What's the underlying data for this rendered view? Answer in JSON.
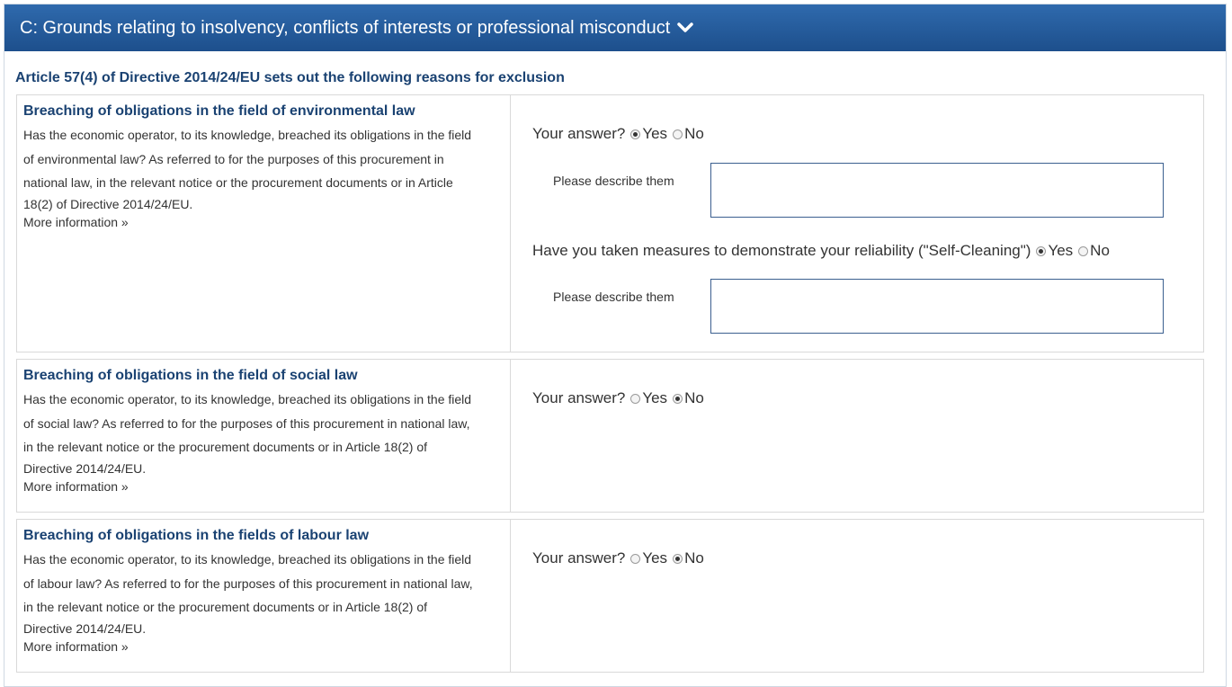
{
  "section": {
    "title": "C: Grounds relating to insolvency, conflicts of interests or professional misconduct",
    "toggle_icon": "chevron-down-icon",
    "intro": "Article 57(4) of Directive 2014/24/EU sets out the following reasons for exclusion"
  },
  "criteria": [
    {
      "title": "Breaching of obligations in the field of environmental law",
      "desc_lines": [
        "Has the economic operator, to its knowledge, breached its obligations in the field",
        "of environmental law? As referred to for the purposes of this procurement in",
        "national law, in the relevant notice or the procurement documents or in Article",
        "18(2) of Directive 2014/24/EU."
      ],
      "more": "More information »",
      "answer_label": "Your answer?",
      "answer": "Yes",
      "describe_label": "Please describe them",
      "selfclean_label": "Have you taken measures to demonstrate your reliability (\"Self-Cleaning\")",
      "selfclean_answer": "Yes",
      "describe_label_2": "Please describe them"
    },
    {
      "title": "Breaching of obligations in the field of social law",
      "desc_lines": [
        "Has the economic operator, to its knowledge, breached its obligations in the field",
        "of social law? As referred to for the purposes of this procurement in national law,",
        "in the relevant notice or the procurement documents or in Article 18(2) of",
        "Directive 2014/24/EU."
      ],
      "more": "More information »",
      "answer_label": "Your answer?",
      "answer": "No"
    },
    {
      "title": "Breaching of obligations in the fields of labour law",
      "desc_lines": [
        "Has the economic operator, to its knowledge, breached its obligations in the field",
        "of labour law? As referred to for the purposes of this procurement in national law,",
        "in the relevant notice or the procurement documents or in Article 18(2) of",
        "Directive 2014/24/EU."
      ],
      "more": "More information »",
      "answer_label": "Your answer?",
      "answer": "No"
    }
  ],
  "options": {
    "yes": "Yes",
    "no": "No"
  }
}
